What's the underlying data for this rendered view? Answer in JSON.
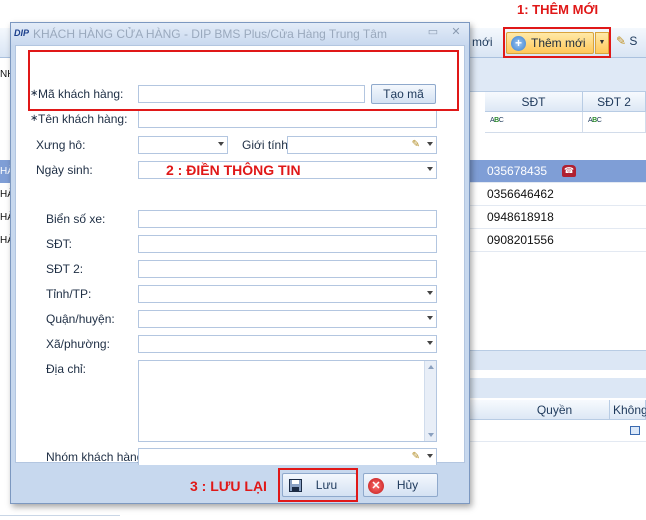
{
  "background": {
    "toolbar": {
      "partial_label": "mới",
      "add_label": "Thêm mới",
      "next_partial_label": "S"
    },
    "grid": {
      "columns": [
        "SĐT",
        "SĐT 2"
      ],
      "filter_placeholder": "ABC",
      "rows": [
        "035678435",
        "0356646462",
        "0948618918",
        "0908201556"
      ],
      "left_fragments": [
        "NH",
        "HÀ",
        "HÀ",
        "HÀ",
        "HÀ"
      ]
    },
    "subgrid": {
      "columns": [
        "Quyền",
        "Không"
      ]
    }
  },
  "dialog": {
    "logo": "DIP",
    "title": "KHÁCH HÀNG CỬA HÀNG - DIP BMS Plus/Cửa Hàng Trung Tâm",
    "required_mark": "∗",
    "fields": {
      "ma_label": "Mã khách hàng:",
      "ten_label": "Tên khách hàng:",
      "xung_ho_label": "Xưng hô:",
      "gioi_tinh_label": "Giới tính:",
      "ngay_sinh_label": "Ngày sinh:",
      "bien_so_label": "Biển số xe:",
      "sdt_label": "SĐT:",
      "sdt2_label": "SĐT 2:",
      "tinh_label": "Tỉnh/TP:",
      "quan_label": "Quận/huyện:",
      "xa_label": "Xã/phường:",
      "dia_chi_label": "Địa chỉ:",
      "nhom_label": "Nhóm khách hàng:"
    },
    "generate_code_label": "Tạo mã",
    "save_label": "Lưu",
    "cancel_label": "Hủy"
  },
  "annotations": {
    "step1": "1: THÊM MỚI",
    "step2": "2 : ĐIỀN THÔNG TIN",
    "step3": "3 : LƯU LẠI"
  },
  "colors": {
    "annotation_red": "#e01818",
    "selected_row": "#7f9ed6",
    "accent_button": "#ffc85a"
  }
}
